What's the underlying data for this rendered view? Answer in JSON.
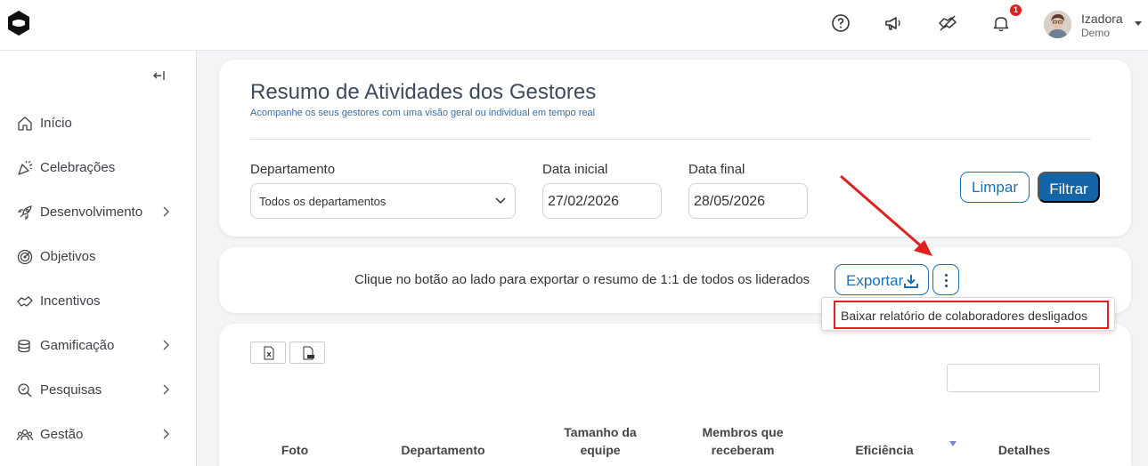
{
  "user": {
    "name": "Izadora",
    "role": "Demo",
    "notification_count": "1"
  },
  "sidebar": {
    "items": [
      {
        "label": "Início",
        "icon": "home-icon"
      },
      {
        "label": "Celebrações",
        "icon": "party-icon"
      },
      {
        "label": "Desenvolvimento",
        "icon": "rocket-icon"
      },
      {
        "label": "Objetivos",
        "icon": "target-icon"
      },
      {
        "label": "Incentivos",
        "icon": "handshake-icon"
      },
      {
        "label": "Gamificação",
        "icon": "coins-icon"
      },
      {
        "label": "Pesquisas",
        "icon": "search-survey-icon"
      },
      {
        "label": "Gestão",
        "icon": "people-icon"
      }
    ]
  },
  "header": {
    "title": "Resumo de Atividades dos Gestores",
    "subtitle": "Acompanhe os seus gestores com uma visão geral ou individual em tempo real"
  },
  "filters": {
    "department_label": "Departamento",
    "department_value": "Todos os departamentos",
    "start_label": "Data inicial",
    "start_value": "27/02/2026",
    "end_label": "Data final",
    "end_value": "28/05/2026",
    "clear_label": "Limpar",
    "filter_label": "Filtrar"
  },
  "export": {
    "description": "Clique no botão ao lado para exportar o resumo de 1:1 de todos os liderados",
    "button_label": "Exportar",
    "menu_item": "Baixar relatório de colaboradores desligados"
  },
  "table": {
    "columns": [
      "Foto",
      "Departamento",
      "Tamanho da equipe",
      "Membros que receberam",
      "Eficiência",
      "Detalhes"
    ]
  },
  "colors": {
    "primary": "#1465a8",
    "highlight": "#e11f1f"
  }
}
